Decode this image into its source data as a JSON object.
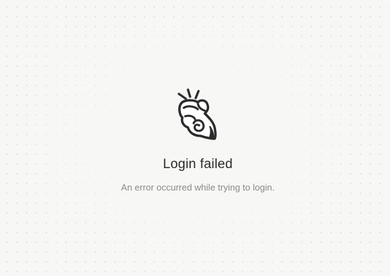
{
  "error": {
    "icon": "snapping-hand-icon",
    "title": "Login failed",
    "message": "An error occurred while trying to login."
  },
  "colors": {
    "background": "#f7f7f5",
    "title": "#2b2b2b",
    "message": "#8a8a86",
    "icon_stroke": "#2b2b2b"
  }
}
